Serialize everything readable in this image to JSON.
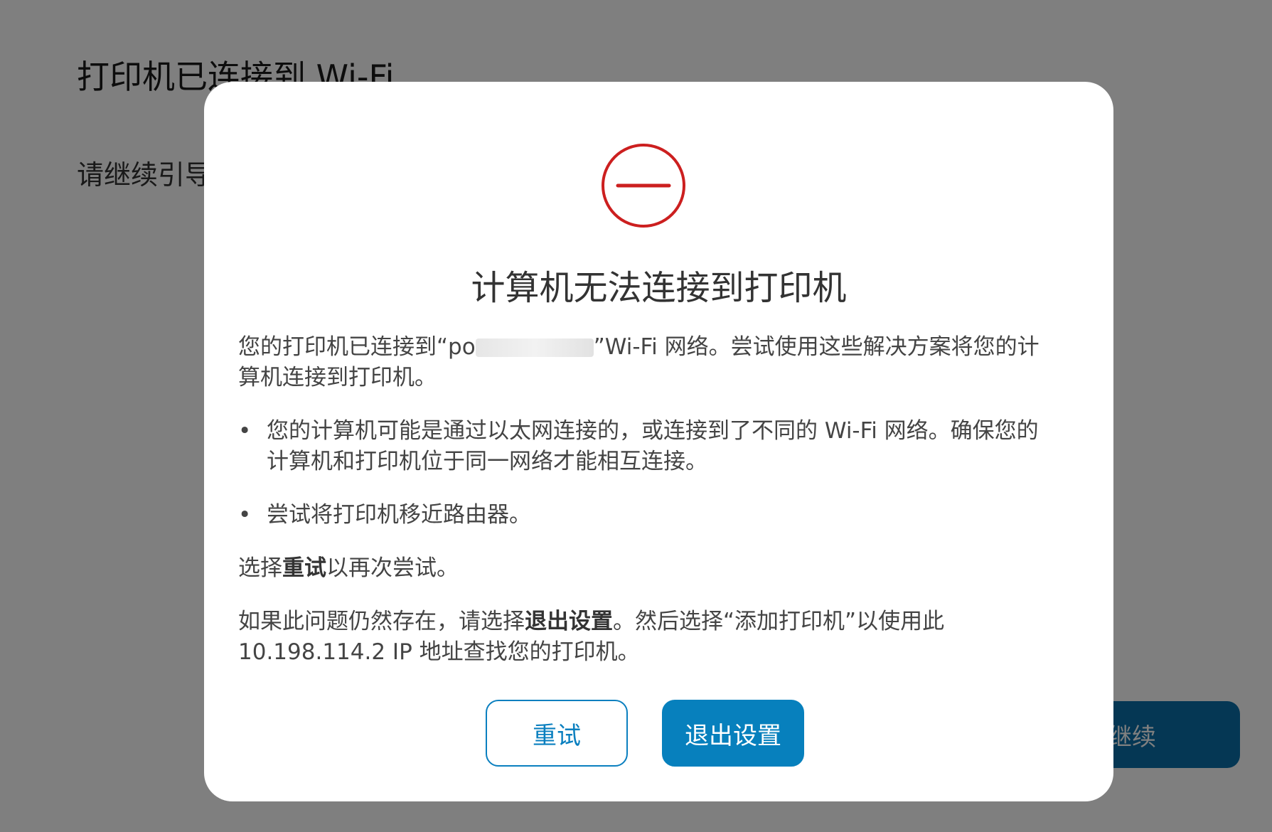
{
  "background": {
    "title": "打印机已连接到 Wi-Fi",
    "subtitle": "请继续引导",
    "continue_button": "继续"
  },
  "dialog": {
    "icon": "error-minus-icon",
    "title": "计算机无法连接到打印机",
    "intro_before": "您的打印机已连接到“po",
    "intro_after": "”Wi-Fi 网络。尝试使用这些解决方案将您的计算机连接到打印机。",
    "bullets": [
      "您的计算机可能是通过以太网连接的，或连接到了不同的 Wi-Fi 网络。确保您的计算机和打印机位于同一网络才能相互连接。",
      "尝试将打印机移近路由器。"
    ],
    "retry_hint_before": "选择",
    "retry_hint_bold": "重试",
    "retry_hint_after": "以再次尝试。",
    "persist_before": "如果此问题仍然存在，请选择",
    "persist_bold": "退出设置",
    "persist_after": "。然后选择“添加打印机”以使用此 10.198.114.2 IP 地址查找您的打印机。",
    "retry_button": "重试",
    "exit_button": "退出设置"
  },
  "colors": {
    "accent": "#0780bd",
    "error": "#cc1f1f",
    "overlay": "rgba(0,0,0,0.5)"
  }
}
